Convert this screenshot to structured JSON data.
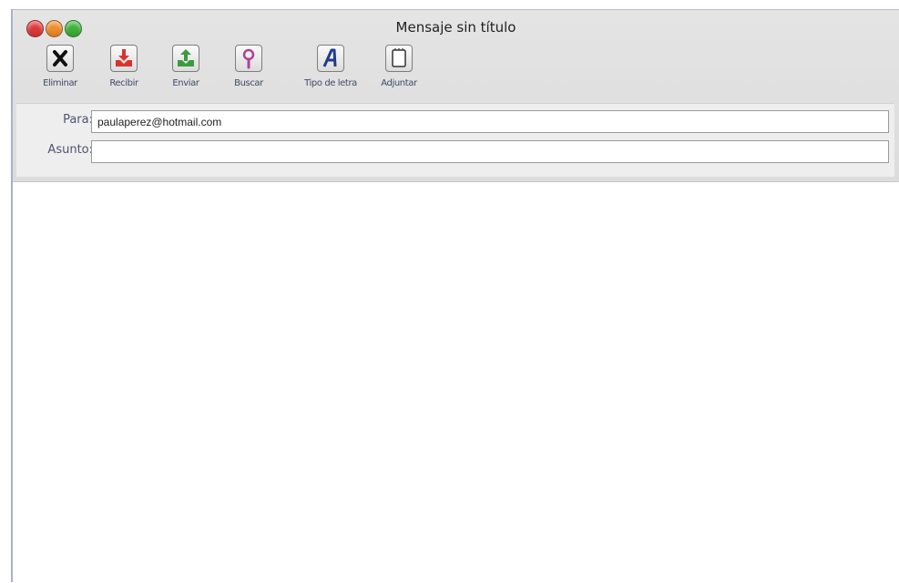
{
  "window": {
    "title": "Mensaje sin título"
  },
  "toolbar": {
    "items": [
      {
        "label": "Eliminar",
        "icon": "delete-icon"
      },
      {
        "label": "Recibir",
        "icon": "receive-icon"
      },
      {
        "label": "Enviar",
        "icon": "send-icon"
      },
      {
        "label": "Buscar",
        "icon": "search-icon"
      },
      {
        "label": "Tipo de letra",
        "icon": "font-icon"
      },
      {
        "label": "Adjuntar",
        "icon": "attach-icon"
      }
    ]
  },
  "compose": {
    "to_label": "Para:",
    "to_value": "paulaperez@hotmail.com",
    "subject_label": "Asunto:",
    "subject_value": "",
    "body": ""
  },
  "colors": {
    "close": "#e0383a",
    "minimize": "#ef8d2a",
    "zoom": "#3db23a",
    "receive_red": "#d9332f",
    "send_green": "#3a9c3e",
    "search_magenta": "#b0409a",
    "font_blue": "#223a8c"
  }
}
